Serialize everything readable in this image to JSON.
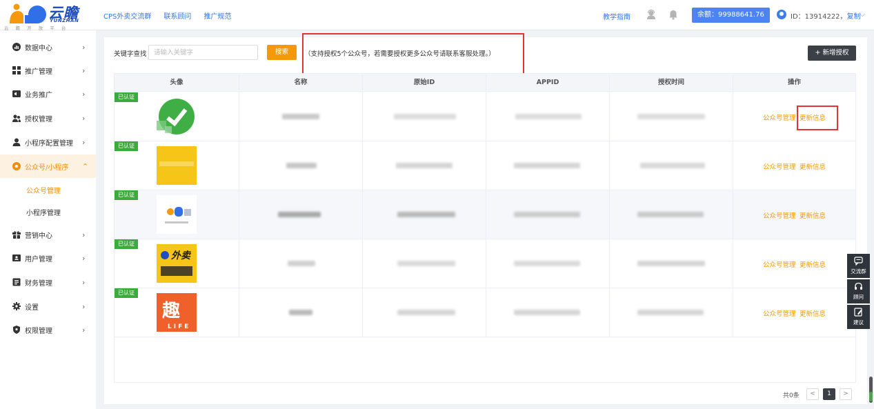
{
  "brand": {
    "name_cn": "云瞻",
    "name_en": "YUNZHAN",
    "tagline": "云 瞻 开 放 平 台"
  },
  "topnav": {
    "links": [
      "CPS外卖交流群",
      "联系顾问",
      "推广规范"
    ],
    "guide": "教学指南",
    "balance": "余额：99988641.76",
    "user_id": "ID：13914222，",
    "copy": "复制"
  },
  "sidebar": {
    "items": [
      {
        "label": "数据中心",
        "icon": "chart-icon"
      },
      {
        "label": "推广管理",
        "icon": "grid-icon"
      },
      {
        "label": "业务推广",
        "icon": "megaphone-icon"
      },
      {
        "label": "授权管理",
        "icon": "users-icon"
      },
      {
        "label": "小程序配置管理",
        "icon": "user-icon"
      },
      {
        "label": "公众号/小程序",
        "icon": "circle-icon"
      },
      {
        "label": "营销中心",
        "icon": "gift-icon"
      },
      {
        "label": "用户管理",
        "icon": "id-card-icon"
      },
      {
        "label": "财务管理",
        "icon": "wallet-icon"
      },
      {
        "label": "设置",
        "icon": "gear-icon"
      },
      {
        "label": "权限管理",
        "icon": "shield-icon"
      }
    ],
    "subitems": [
      "公众号管理",
      "小程序管理"
    ],
    "active_item": "公众号/小程序",
    "active_sub": "公众号管理"
  },
  "toolbar": {
    "keyword_label": "关键字查找",
    "keyword_placeholder": "请输入关键字",
    "keyword_value": "",
    "search_label": "搜索",
    "notice": "（支持授权5个公众号，若需要授权更多公众号请联系客服处理。）",
    "add_label": "+ 新增授权"
  },
  "table": {
    "headers": [
      "头像",
      "名称",
      "原始ID",
      "APPID",
      "授权时间",
      "操作"
    ],
    "verified_badge": "已认证",
    "action_manage": "公众号管理",
    "action_update": "更新信息",
    "rows": [
      {
        "avatar": "green-check-logo",
        "verified": true
      },
      {
        "avatar": "yellow-logo",
        "verified": true
      },
      {
        "avatar": "yunzhan-logo",
        "verified": true
      },
      {
        "avatar": "waimai-logo",
        "verified": true
      },
      {
        "avatar": "qu-life-logo",
        "verified": true
      }
    ],
    "avatar_texts": {
      "waimai": "外卖",
      "qu": "趣",
      "life": "LIFE"
    }
  },
  "pagination": {
    "total": "共0条",
    "current": "1",
    "prev": "<",
    "next": ">"
  },
  "float_tools": [
    {
      "label": "交流群",
      "icon": "chat-icon"
    },
    {
      "label": "顾问",
      "icon": "headset-icon"
    },
    {
      "label": "建议",
      "icon": "edit-icon"
    }
  ],
  "colors": {
    "accent_orange": "#f5980c",
    "link_blue": "#3775e6",
    "balance_blue": "#4d84f4",
    "verified_green": "#3bab3b",
    "dark_button": "#3b3f46",
    "annotation_red": "#e23434"
  }
}
